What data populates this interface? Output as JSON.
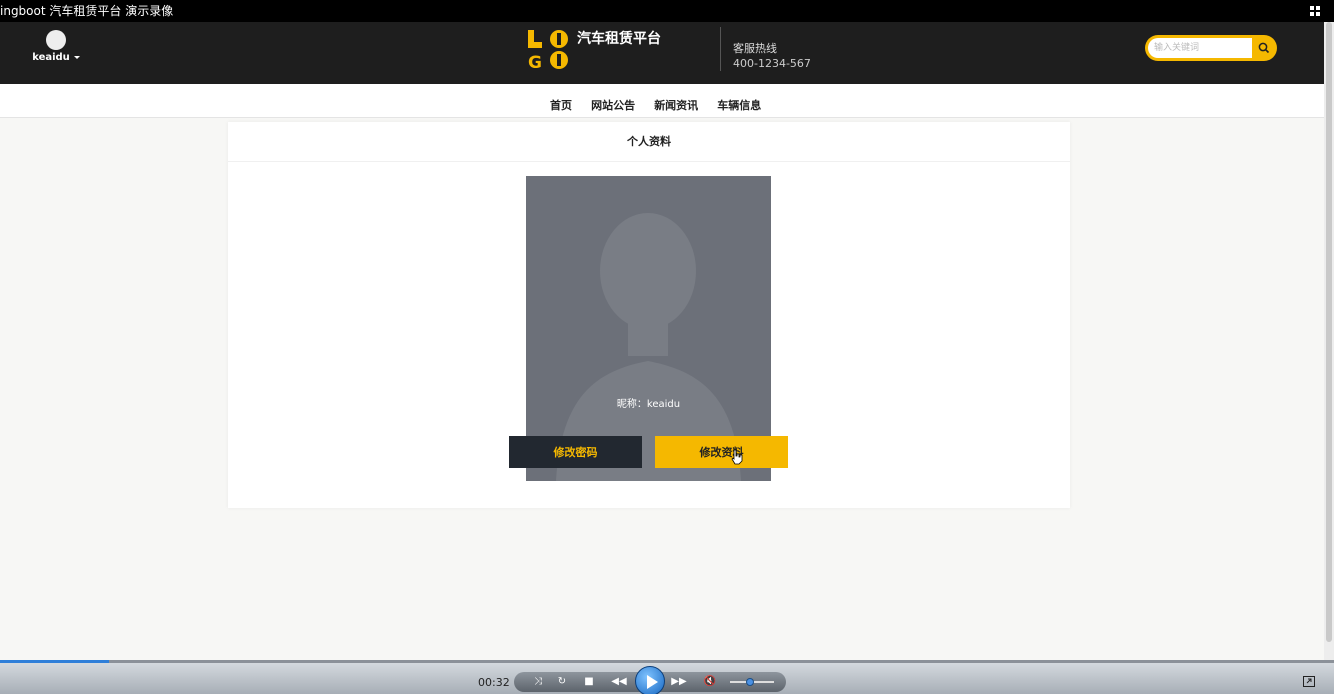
{
  "window": {
    "title": "ingboot 汽车租赁平台 演示录像"
  },
  "header": {
    "username": "keaidu",
    "brand": "汽车租赁平台",
    "hotline_label": "客服热线",
    "hotline_number": "400-1234-567",
    "search_placeholder": "输入关键词",
    "colors": {
      "accent": "#f5b800",
      "header_bg": "#1e1e1e"
    }
  },
  "nav": {
    "items": [
      "首页",
      "网站公告",
      "新闻资讯",
      "车辆信息"
    ]
  },
  "profile": {
    "title": "个人资料",
    "nickname": "昵称：keaidu",
    "change_password": "修改密码",
    "edit_profile": "修改资料"
  },
  "player": {
    "time": "00:32",
    "progress": 0.082
  }
}
